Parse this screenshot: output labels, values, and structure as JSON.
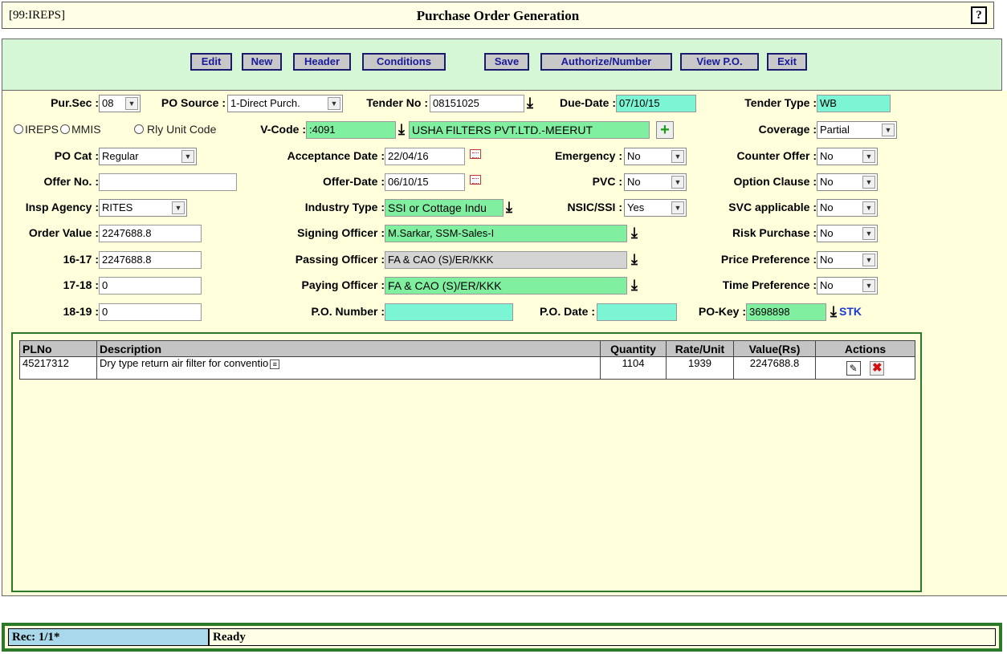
{
  "titlebar": {
    "app_tag": "[99:IREPS]",
    "title": "Purchase Order Generation",
    "help_icon": "?"
  },
  "toolbar": {
    "edit": "Edit",
    "new": "New",
    "header": "Header",
    "conditions": "Conditions",
    "save": "Save",
    "authorize": "Authorize/Number",
    "view_po": "View P.O.",
    "exit": "Exit"
  },
  "form": {
    "pur_sec": {
      "label": "Pur.Sec :",
      "value": "08"
    },
    "po_source": {
      "label": "PO Source :",
      "value": "1-Direct Purch."
    },
    "tender_no": {
      "label": "Tender No :",
      "value": "08151025"
    },
    "due_date": {
      "label": "Due-Date :",
      "value": "07/10/15"
    },
    "tender_type": {
      "label": "Tender Type :",
      "value": "WB"
    },
    "radios": {
      "ireps": "IREPS",
      "mmis": "MMIS",
      "rly": "Rly Unit Code"
    },
    "vcode": {
      "label": "V-Code :",
      "value": ":4091",
      "vendor": "USHA FILTERS PVT.LTD.-MEERUT"
    },
    "coverage": {
      "label": "Coverage :",
      "value": "Partial"
    },
    "po_cat": {
      "label": "PO Cat :",
      "value": "Regular"
    },
    "acceptance_date": {
      "label": "Acceptance Date :",
      "value": "22/04/16"
    },
    "emergency": {
      "label": "Emergency :",
      "value": "No"
    },
    "counter_offer": {
      "label": "Counter Offer :",
      "value": "No"
    },
    "offer_no": {
      "label": "Offer No. :",
      "value": ""
    },
    "offer_date": {
      "label": "Offer-Date :",
      "value": "06/10/15"
    },
    "pvc": {
      "label": "PVC :",
      "value": "No"
    },
    "option_clause": {
      "label": "Option Clause :",
      "value": "No"
    },
    "insp_agency": {
      "label": "Insp Agency :",
      "value": "RITES"
    },
    "industry_type": {
      "label": "Industry Type :",
      "value": "SSI or Cottage Indu"
    },
    "nsic_ssi": {
      "label": "NSIC/SSI :",
      "value": "Yes"
    },
    "svc_applicable": {
      "label": "SVC applicable :",
      "value": "No"
    },
    "order_value": {
      "label": "Order Value :",
      "value": "2247688.8"
    },
    "signing_officer": {
      "label": "Signing Officer :",
      "value": "M.Sarkar, SSM-Sales-I"
    },
    "risk_purchase": {
      "label": "Risk Purchase :",
      "value": "No"
    },
    "y1617": {
      "label": "16-17 :",
      "value": "2247688.8"
    },
    "passing_officer": {
      "label": "Passing Officer :",
      "value": "FA & CAO (S)/ER/KKK"
    },
    "price_preference": {
      "label": "Price Preference :",
      "value": "No"
    },
    "y1718": {
      "label": "17-18 :",
      "value": "0"
    },
    "paying_officer": {
      "label": "Paying Officer :",
      "value": "FA & CAO (S)/ER/KKK"
    },
    "time_preference": {
      "label": "Time Preference :",
      "value": "No"
    },
    "y1819": {
      "label": "18-19 :",
      "value": "0"
    },
    "po_number": {
      "label": "P.O. Number :",
      "value": ""
    },
    "po_date": {
      "label": "P.O. Date :",
      "value": ""
    },
    "po_key": {
      "label": "PO-Key :",
      "value": "3698898",
      "stk": "STK"
    }
  },
  "grid": {
    "headers": [
      "PLNo",
      "Description",
      "Quantity",
      "Rate/Unit",
      "Value(Rs)",
      "Actions"
    ],
    "rows": [
      {
        "plno": "45217312",
        "description": "Dry type return air filter for conventio",
        "quantity": "1104",
        "rate": "1939",
        "value": "2247688.8"
      }
    ]
  },
  "status": {
    "rec": "Rec: 1/1*",
    "message": "Ready"
  }
}
